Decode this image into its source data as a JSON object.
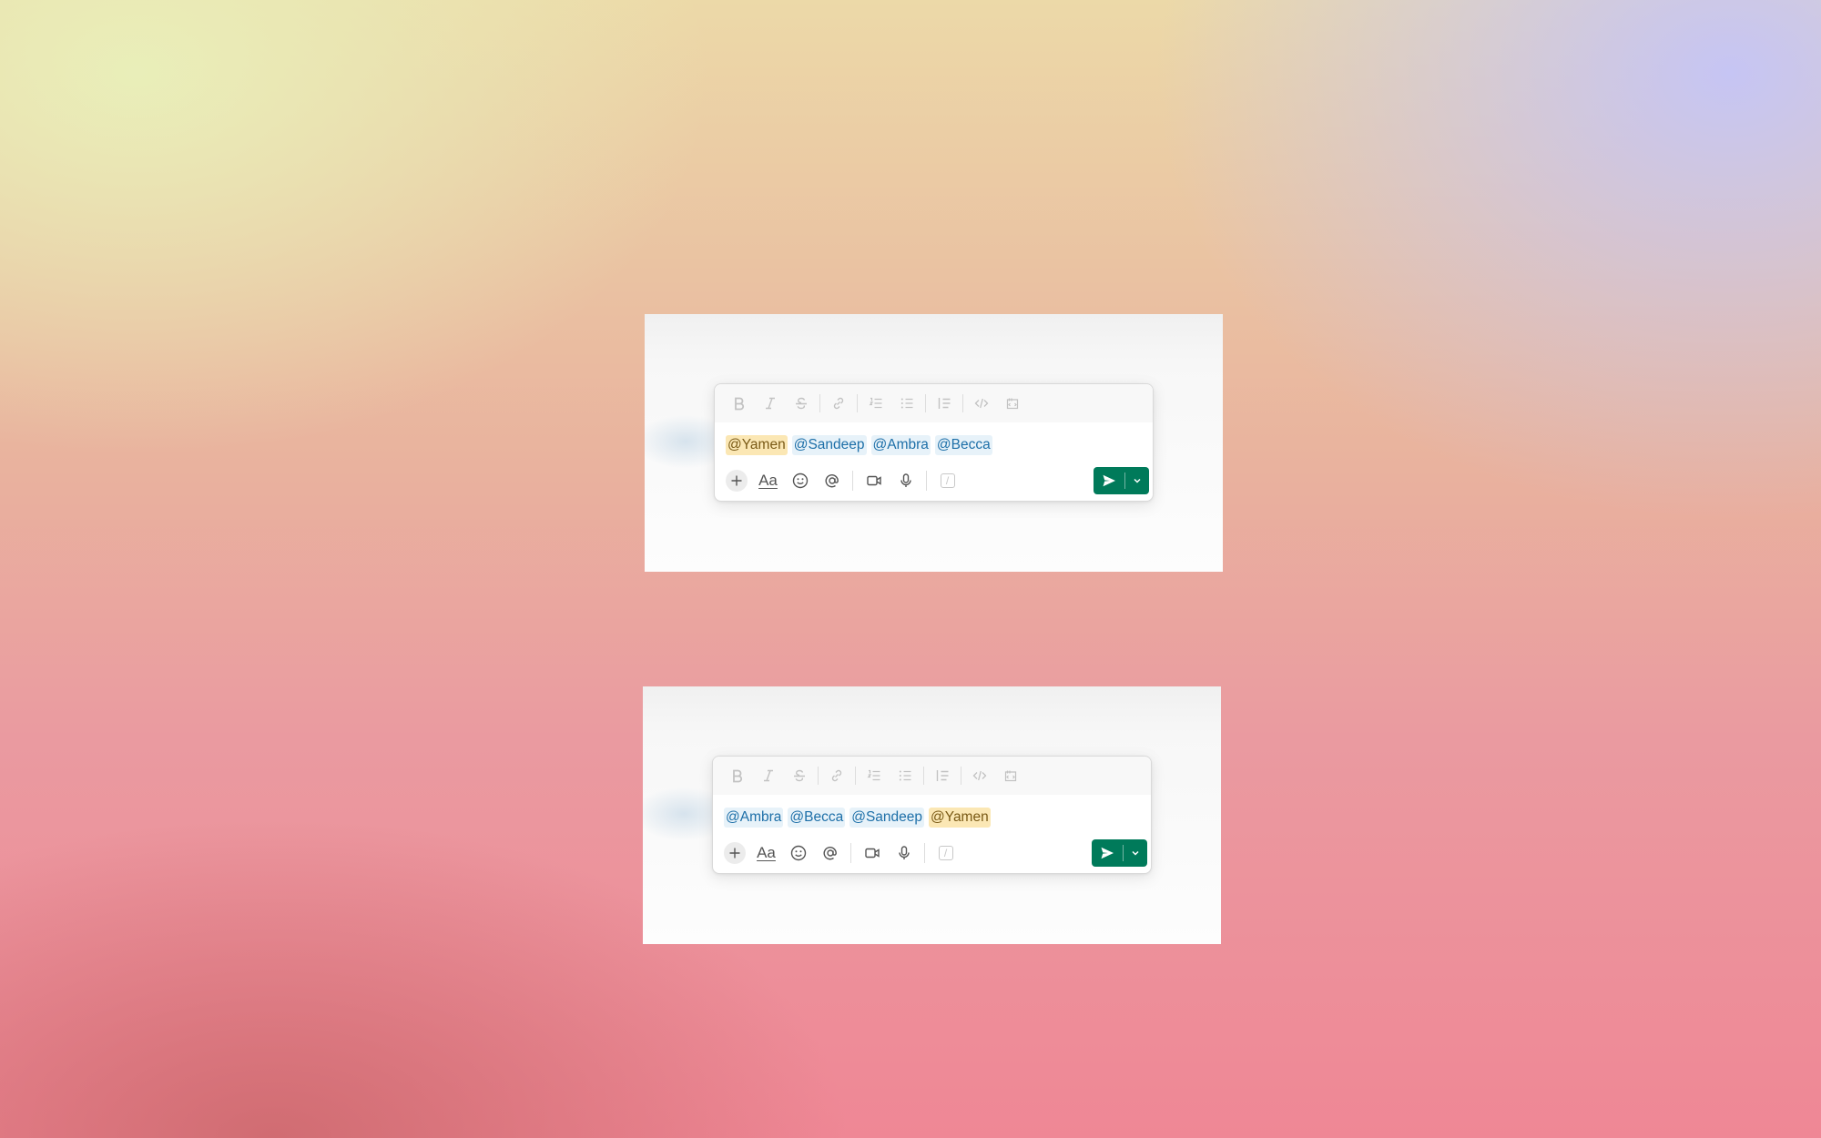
{
  "colors": {
    "send_button": "#007a5a",
    "mention_text": "#1d6fa8",
    "mention_bg": "#e7f2f9",
    "self_mention_bg": "#fbe7b4"
  },
  "format_toolbar": {
    "icons": [
      "bold-icon",
      "italic-icon",
      "strikethrough-icon",
      "link-icon",
      "ordered-list-icon",
      "bulleted-list-icon",
      "blockquote-icon",
      "code-icon",
      "code-block-icon"
    ]
  },
  "action_toolbar": {
    "format_label": "Aa",
    "slash_label": "/",
    "icons": [
      "plus-icon",
      "emoji-icon",
      "at-mention-icon",
      "video-icon",
      "microphone-icon",
      "slash-command-icon",
      "send-icon",
      "chevron-down-icon"
    ]
  },
  "composers": [
    {
      "mentions": [
        {
          "text": "@Yamen",
          "self": true
        },
        {
          "text": "@Sandeep",
          "self": false
        },
        {
          "text": "@Ambra",
          "self": false
        },
        {
          "text": "@Becca",
          "self": false
        }
      ]
    },
    {
      "mentions": [
        {
          "text": "@Ambra",
          "self": false
        },
        {
          "text": "@Becca",
          "self": false
        },
        {
          "text": "@Sandeep",
          "self": false
        },
        {
          "text": "@Yamen",
          "self": true
        }
      ]
    }
  ]
}
